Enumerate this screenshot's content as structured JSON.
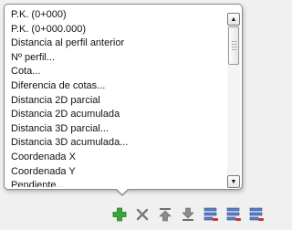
{
  "dropdown": {
    "items": [
      "P.K. (0+000)",
      "P.K. (0+000.000)",
      "Distancia al perfil anterior",
      "Nº perfil...",
      "Cota...",
      "Diferencia de cotas...",
      "Distancia 2D parcial",
      "Distancia 2D acumulada",
      "Distancia 3D parcial...",
      "Distancia 3D acumulada...",
      "Coordenada X",
      "Coordenada Y",
      "Pendiente..."
    ],
    "scroll_up_glyph": "▲",
    "scroll_down_glyph": "▼"
  },
  "toolbar": {
    "buttons": [
      {
        "icon": "add-icon",
        "color": "#3aa53a"
      },
      {
        "icon": "delete-icon",
        "color": "#7a7a7a"
      },
      {
        "icon": "move-up-icon",
        "color": "#6e6e6e"
      },
      {
        "icon": "move-down-icon",
        "color": "#6e6e6e"
      },
      {
        "icon": "list-remove-icon",
        "color": "#d03030"
      },
      {
        "icon": "list-remove-icon",
        "color": "#d03030"
      },
      {
        "icon": "list-remove-icon",
        "color": "#d03030"
      }
    ]
  }
}
